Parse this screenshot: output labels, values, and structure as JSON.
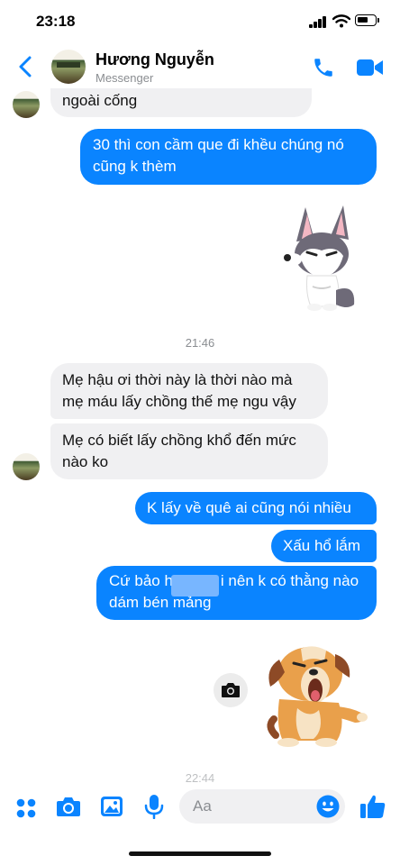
{
  "status": {
    "time": "23:18"
  },
  "header": {
    "name": "Hương Nguyễn",
    "subtitle": "Messenger"
  },
  "messages": [
    {
      "side": "in",
      "text": "ngoài cống"
    },
    {
      "side": "out",
      "text": "30 thì con cầm que đi khều chúng nó cũng k thèm"
    },
    {
      "side": "in",
      "text": "Mẹ hậu ơi thời này là thời nào mà mẹ máu lấy chồng thế mẹ ngu vậy"
    },
    {
      "side": "in",
      "text": "Mẹ có biết lấy chồng khổ đến mức nào ko"
    },
    {
      "side": "out",
      "text": "K lấy về quê ai cũng nói nhiều"
    },
    {
      "side": "out",
      "text": "Xấu hổ lắm"
    },
    {
      "side": "out",
      "text_line1_a": "Cứ bảo h",
      "text_line1_b": "i nên k có thằng nào",
      "text_line2": "dám bén mảng"
    }
  ],
  "timestamps": [
    "21:46",
    "22:44"
  ],
  "stickers": [
    "husky-sticker",
    "puppy-sticker"
  ],
  "composer": {
    "placeholder": "Aa"
  },
  "colors": {
    "accent": "#0a84ff",
    "incoming": "#f0f0f2"
  }
}
